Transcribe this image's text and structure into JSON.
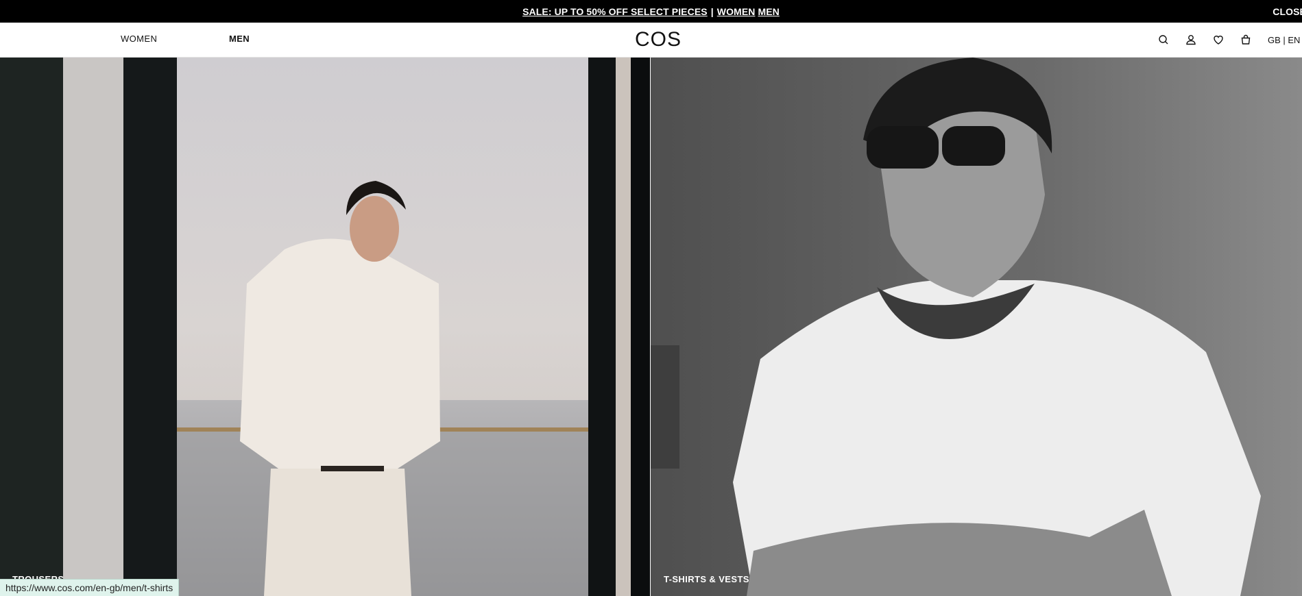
{
  "promo": {
    "sale_text": "SALE: UP TO 50% OFF SELECT PIECES",
    "separator": "|",
    "women_link": "WOMEN",
    "men_link": "MEN",
    "close_label": "CLOSE"
  },
  "header": {
    "nav": [
      {
        "label": "WOMEN"
      },
      {
        "label": "MEN"
      }
    ],
    "logo": "COS",
    "icons": [
      "search-icon",
      "account-icon",
      "heart-icon",
      "bag-icon"
    ],
    "locale": "GB | EN"
  },
  "hero": {
    "left": {
      "caption": "TROUSERS"
    },
    "right": {
      "caption": "T-SHIRTS & VESTS"
    }
  },
  "status_bar": {
    "url": "https://www.cos.com/en-gb/men/t-shirts"
  },
  "colors": {
    "promo_bg": "#000000",
    "status_bg": "#dff3ec"
  }
}
